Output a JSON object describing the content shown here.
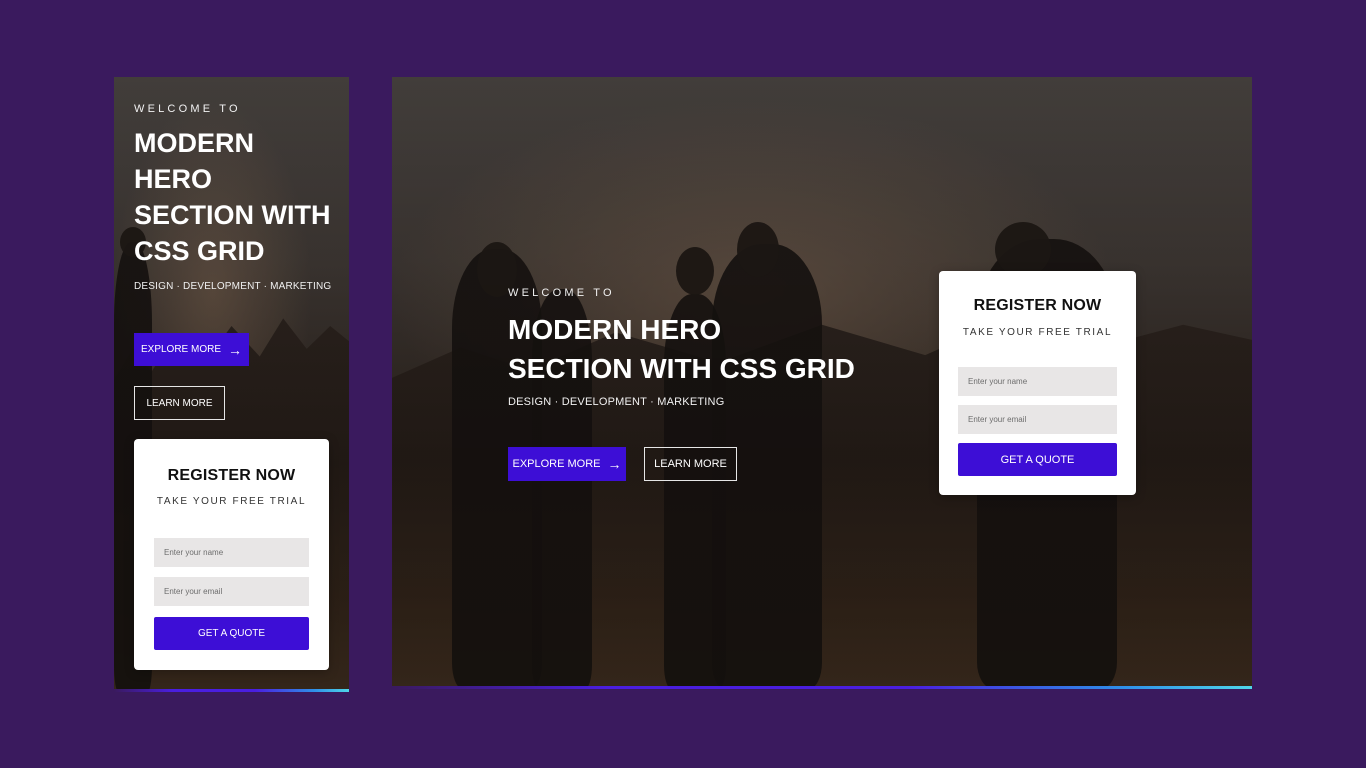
{
  "colors": {
    "page_background": "#3a1a5e",
    "primary_button": "#3d0ed6",
    "card_background": "#ffffff",
    "field_background": "#e8e6e6",
    "accent_gradient_end": "#4fd6e8"
  },
  "hero": {
    "eyebrow": "WELCOME TO",
    "headline_mobile": "MODERN HERO SECTION WITH CSS GRID",
    "headline_line1": "MODERN HERO",
    "headline_line2": "SECTION WITH CSS GRID",
    "tagline": "DESIGN · DEVELOPMENT · MARKETING",
    "explore_label": "EXPLORE MORE",
    "explore_icon": "arrow-right-icon",
    "learn_label": "LEARN MORE"
  },
  "register": {
    "title": "REGISTER NOW",
    "subtitle": "TAKE YOUR FREE TRIAL",
    "name_placeholder": "Enter your name",
    "email_placeholder": "Enter your email",
    "submit_label": "GET A QUOTE"
  }
}
